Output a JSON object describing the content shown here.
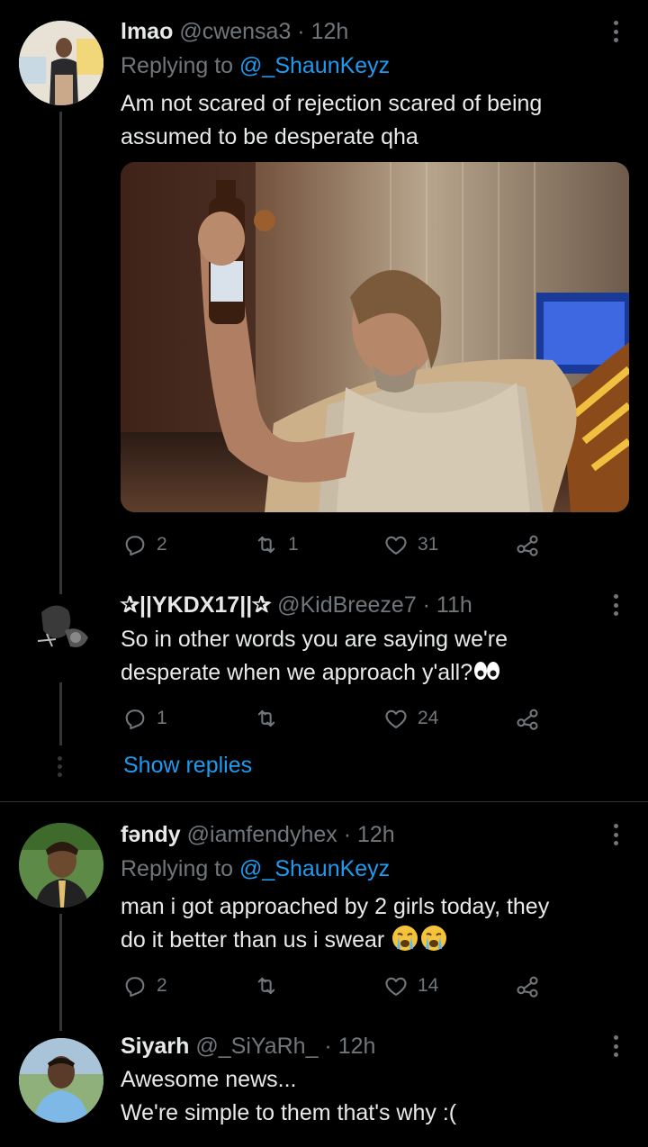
{
  "tweets": [
    {
      "name": "lmao",
      "handle": "@cwensa3 · 12h",
      "replying_prefix": "Replying to ",
      "replying_to": "@_ShaunKeyz",
      "text": "Am not scared of rejection scared of being assumed to be desperate qha",
      "has_media": true,
      "replies": "2",
      "retweets": "1",
      "likes": "31"
    },
    {
      "name": "✰||YKDX17||✰",
      "handle": "@KidBreeze7 · 11h",
      "text_line1": "So in other words you are saying we're",
      "text_line2": "desperate when we approach y'all?",
      "replies": "1",
      "retweets": "",
      "likes": "24",
      "show_replies": "Show replies"
    },
    {
      "name": "fəndy",
      "handle": "@iamfendyhex · 12h",
      "replying_prefix": "Replying to ",
      "replying_to": "@_ShaunKeyz",
      "text_line1": "man i got approached by 2 girls today, they",
      "text_line2": "do it better than us i swear",
      "replies": "2",
      "retweets": "",
      "likes": "14"
    },
    {
      "name": "Siyarh",
      "handle": "@_SiYaRh_ · 12h",
      "text_line1": "Awesome news...",
      "text_line2": "We're simple to them that's why :("
    }
  ],
  "icons": {
    "reply": "reply-icon",
    "retweet": "retweet-icon",
    "like": "heart-icon",
    "share": "share-icon",
    "more": "more-dots-icon"
  },
  "colors": {
    "background": "#000000",
    "text": "#e7e9ea",
    "muted": "#71767b",
    "link": "#1d9bf0"
  }
}
